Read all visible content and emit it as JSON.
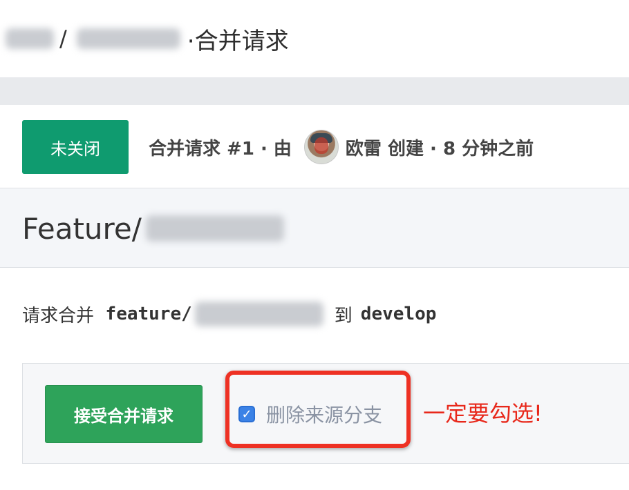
{
  "breadcrumb": {
    "separator": "/",
    "dot": "·",
    "page": "合并请求"
  },
  "status": {
    "badge": "未关闭",
    "mr_label": "合并请求 #1 · 由",
    "author": "欧雷",
    "created": "创建 · 8 分钟之前"
  },
  "title": {
    "prefix": "Feature/"
  },
  "branch": {
    "request_label": "请求合并",
    "source_prefix": "feature/",
    "to_label": "到",
    "target": "develop"
  },
  "merge": {
    "accept_button": "接受合并请求",
    "delete_branch_label": "删除来源分支",
    "delete_branch_checked": true,
    "annotation": "一定要勾选!"
  },
  "colors": {
    "open_badge": "#0f9b6f",
    "accept_button": "#2ea35a",
    "annotation_red": "#ee3124",
    "checkbox_blue": "#3b82e6"
  }
}
